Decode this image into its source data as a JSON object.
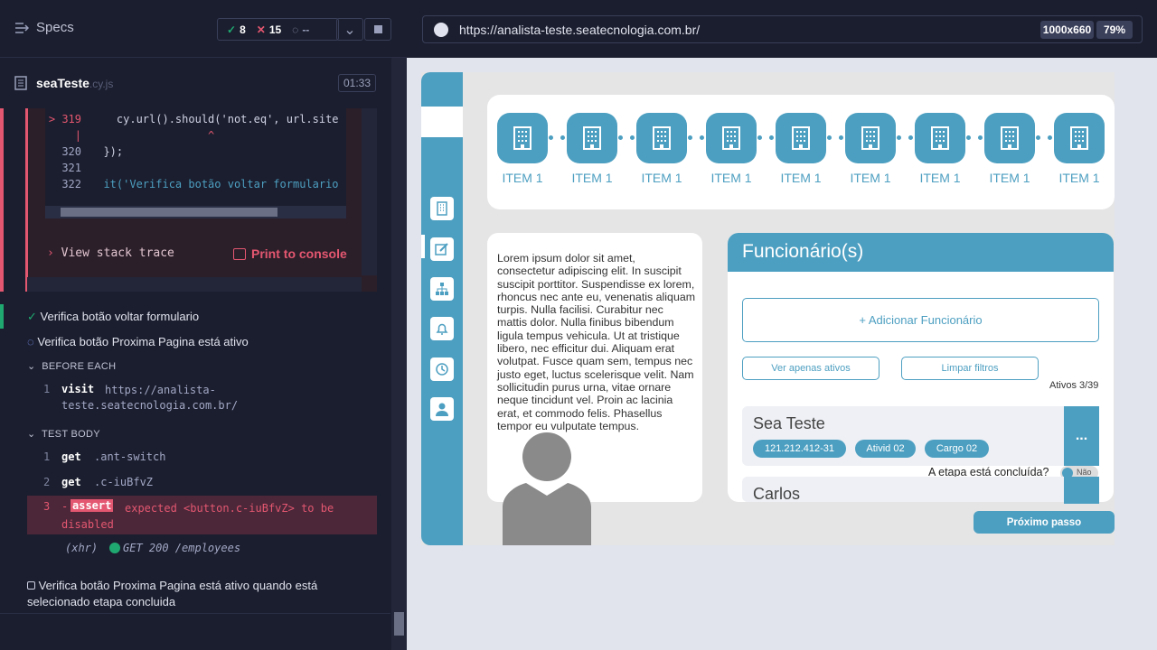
{
  "runner": {
    "specs_label": "Specs",
    "passed": "8",
    "failed": "15",
    "pending": "--",
    "spec_file": "seaTeste",
    "spec_ext": ".cy.js",
    "duration": "01:33",
    "code_lines": [
      {
        "num": "> 319",
        "text": "    cy.url().should('not.eq', url.site"
      },
      {
        "num": "",
        "text": "                  ^"
      },
      {
        "num": "320",
        "text": "  });"
      },
      {
        "num": "321",
        "text": ""
      },
      {
        "num": "322",
        "text": "  it('Verifica botão voltar formulario"
      }
    ],
    "view_stack": "View stack trace",
    "print_console": "Print to console",
    "tests": [
      "Verifica botão voltar formulario",
      "Verifica botão Proxima Pagina está ativo",
      "Verifica botão Proxima Pagina está ativo quando está selecionado etapa concluida"
    ],
    "before_each": "BEFORE EACH",
    "test_body": "TEST BODY",
    "cmd_visit": {
      "num": "1",
      "cmd": "visit",
      "arg": "https://analista-teste.seatecnologia.com.br/"
    },
    "cmd_get1": {
      "num": "1",
      "cmd": "get",
      "arg": ".ant-switch"
    },
    "cmd_get2": {
      "num": "2",
      "cmd": "get",
      "arg": ".c-iuBfvZ"
    },
    "cmd_assert": {
      "num": "3",
      "cmd": "assert",
      "arg": "expected <button.c-iuBfvZ> to be disabled"
    },
    "xhr": {
      "label": "(xhr)",
      "text": "GET 200 /employees"
    }
  },
  "browser": {
    "url": "https://analista-teste.seatecnologia.com.br/",
    "viewport": "1000x660",
    "zoom": "79%"
  },
  "app": {
    "step_labels": [
      "ITEM 1",
      "ITEM 1",
      "ITEM 1",
      "ITEM 1",
      "ITEM 1",
      "ITEM 1",
      "ITEM 1",
      "ITEM 1",
      "ITEM 1"
    ],
    "lorem": "Lorem ipsum dolor sit amet, consectetur adipiscing elit. In suscipit suscipit porttitor. Suspendisse ex lorem, rhoncus nec ante eu, venenatis aliquam turpis. Nulla facilisi. Curabitur nec mattis dolor. Nulla finibus bibendum ligula tempus vehicula. Ut at tristique libero, nec efficitur dui. Aliquam erat volutpat. Fusce quam sem, tempus nec justo eget, luctus scelerisque velit. Nam sollicitudin purus urna, vitae ornare neque tincidunt vel. Proin ac lacinia erat, et commodo felis. Phasellus tempor        eu vulputate tempus.",
    "panel_title": "Funcionário(s)",
    "add_button": "+ Adicionar Funcionário",
    "filter_active": "Ver apenas ativos",
    "filter_clear": "Limpar filtros",
    "active_count": "Ativos 3/39",
    "employee1": {
      "name": "Sea Teste",
      "cpf": "121.212.412-31",
      "activity": "Ativid 02",
      "role": "Cargo 02",
      "more": "..."
    },
    "employee2": {
      "name": "Carlos"
    },
    "stage_done": "A etapa está concluída?",
    "toggle_label": "Não",
    "next_button": "Próximo passo",
    "brand_color": "#4d9fc1"
  }
}
